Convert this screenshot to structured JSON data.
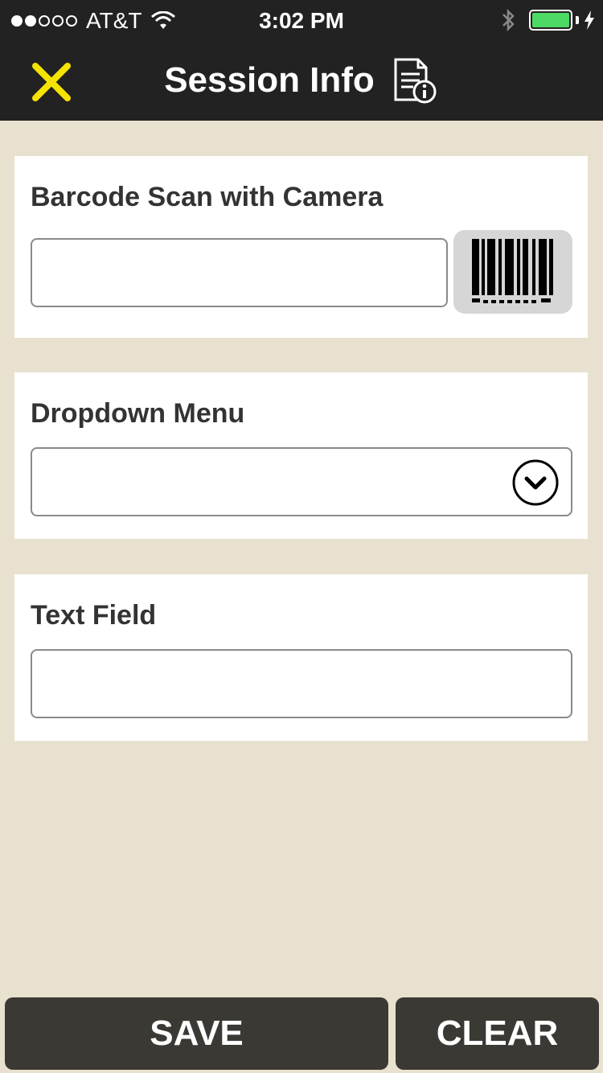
{
  "status_bar": {
    "carrier": "AT&T",
    "time": "3:02 PM",
    "signal_filled": 2,
    "signal_total": 5
  },
  "nav": {
    "title": "Session Info",
    "close_icon": "close-icon",
    "info_icon": "document-info-icon"
  },
  "barcode_section": {
    "label": "Barcode Scan with Camera",
    "value": "",
    "scan_icon": "barcode-icon"
  },
  "dropdown_section": {
    "label": "Dropdown Menu",
    "selected": "",
    "chevron_icon": "chevron-down-icon"
  },
  "text_section": {
    "label": "Text Field",
    "value": ""
  },
  "footer": {
    "save_label": "SAVE",
    "clear_label": "CLEAR"
  },
  "colors": {
    "background": "#e8e1cf",
    "bar": "#222222",
    "accent_close": "#f5e400",
    "battery": "#4cd964",
    "button": "#3a3934"
  }
}
